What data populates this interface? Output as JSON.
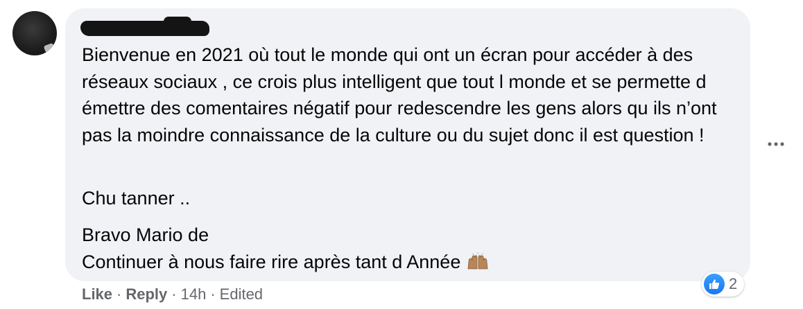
{
  "comment": {
    "paragraphs": {
      "p1": "Bienvenue en 2021 où tout le monde qui ont un écran pour accéder à des réseaux sociaux , ce crois plus intelligent que tout l monde et se permette d émettre des comentaires négatif pour redescendre les gens alors qu ils n’ont pas la moindre connaissance de la culture ou du sujet donc il est question !",
      "p2": "Chu tanner ..",
      "p3_line1": "Bravo Mario de",
      "p3_line2": "Continuer à nous faire rire après tant d Année"
    },
    "emoji": "raising-hands-icon"
  },
  "reactions": {
    "type": "like",
    "count": "2"
  },
  "actions": {
    "like": "Like",
    "separator": "·",
    "reply": "Reply",
    "time": "14h",
    "edited": "Edited"
  },
  "colors": {
    "bubble": "#f0f2f5",
    "secondary_text": "#65676b",
    "like_blue": "#1877f2"
  }
}
